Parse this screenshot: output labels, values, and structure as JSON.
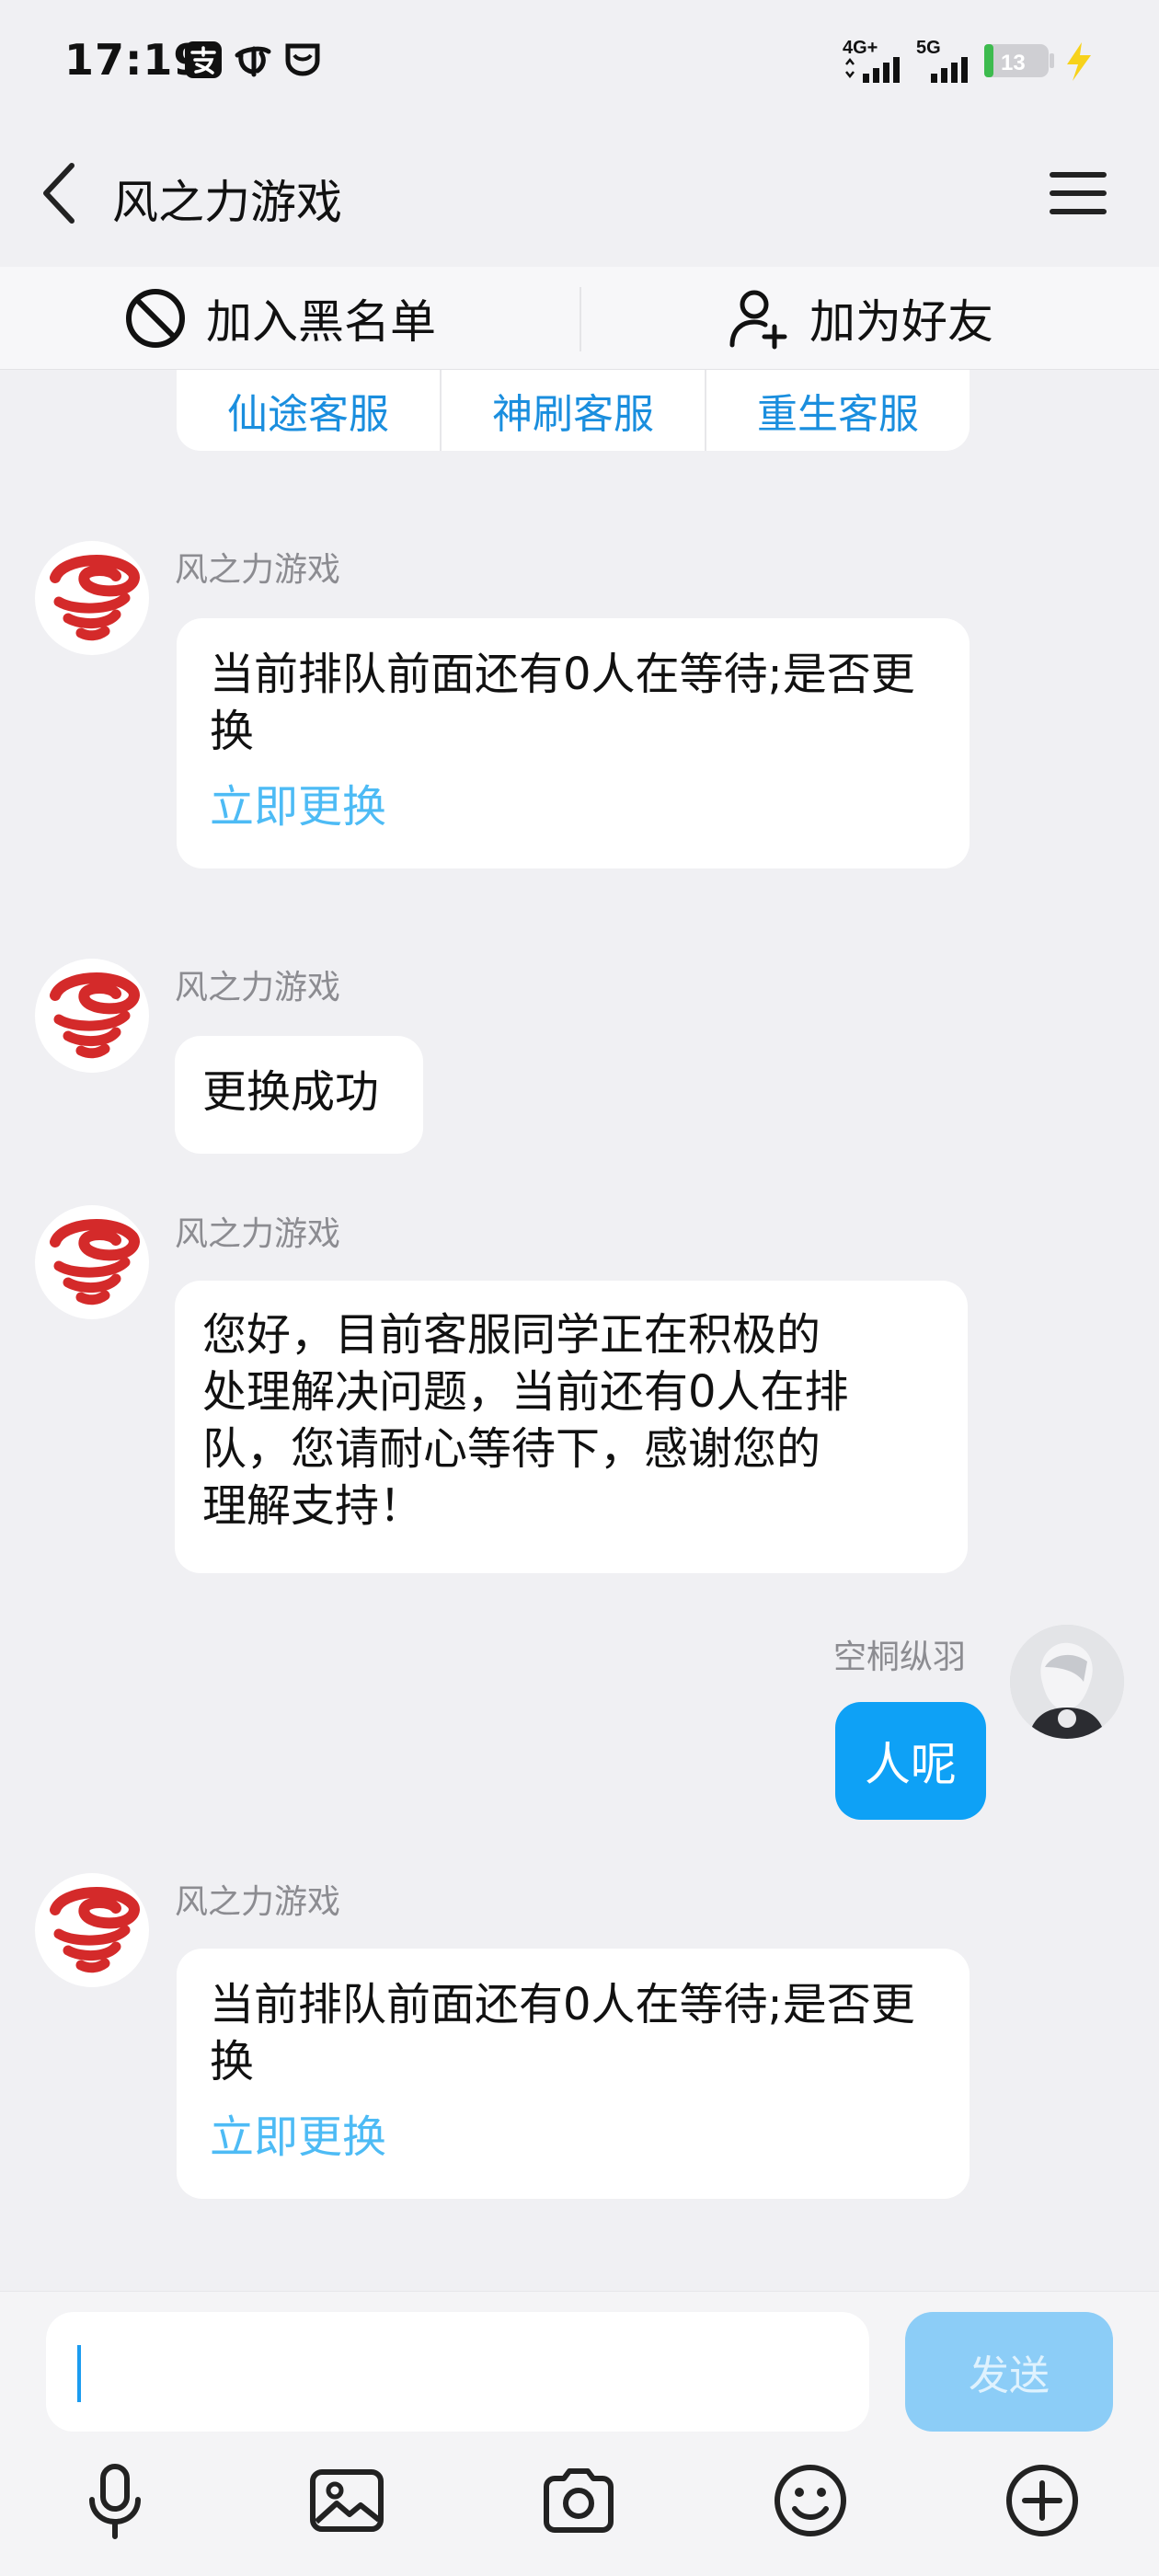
{
  "status_bar": {
    "time": "17:19",
    "network_1": "4G+",
    "network_2": "5G",
    "battery": "13",
    "app_icons": [
      "alipay-icon",
      "telecom-icon",
      "cup-icon"
    ]
  },
  "header": {
    "title": "风之力游戏",
    "back_icon": "chevron-left-icon",
    "menu_icon": "hamburger-menu-icon"
  },
  "actions": {
    "block_label": "加入黑名单",
    "add_friend_label": "加为好友"
  },
  "quick_replies": [
    "仙途客服",
    "神刷客服",
    "重生客服"
  ],
  "messages": [
    {
      "sender": "风之力游戏",
      "lines": [
        "当前排队前面还有0人在等待;是否更",
        "换"
      ],
      "link": "立即更换"
    },
    {
      "sender": "风之力游戏",
      "lines": [
        "更换成功"
      ]
    },
    {
      "sender": "风之力游戏",
      "lines": [
        "您好，目前客服同学正在积极的",
        "处理解决问题，当前还有0人在排",
        "队，您请耐心等待下，感谢您的",
        "理解支持！"
      ]
    },
    {
      "sender": "空桐纵羽",
      "lines": [
        "人呢"
      ],
      "self": true
    },
    {
      "sender": "风之力游戏",
      "lines": [
        "当前排队前面还有0人在等待;是否更",
        "换"
      ],
      "link": "立即更换"
    }
  ],
  "composer": {
    "input_value": "",
    "send_label": "发送",
    "tools": [
      "microphone-icon",
      "image-icon",
      "camera-icon",
      "emoji-icon",
      "plus-icon"
    ]
  },
  "colors": {
    "accent": "#0ea1f6",
    "link": "#4dbbf5",
    "send_disabled": "#8ccdf7",
    "background": "#f0f0f3",
    "brand_red": "#d42a2a"
  }
}
